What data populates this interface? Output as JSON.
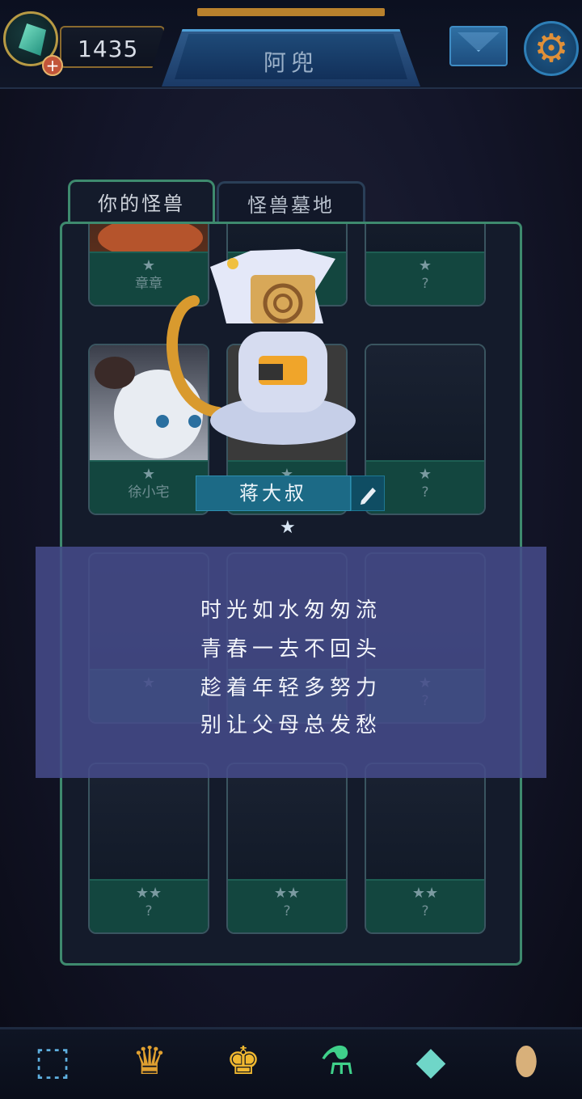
{
  "header": {
    "currency_value": "1435",
    "plus_label": "+",
    "title": "阿兜"
  },
  "tabs": [
    {
      "label": "你的怪兽",
      "active": true
    },
    {
      "label": "怪兽墓地",
      "active": false
    }
  ],
  "cards": [
    {
      "name": "章章",
      "stars": "★"
    },
    {
      "name": "",
      "stars": "★"
    },
    {
      "name": "?",
      "stars": "★"
    },
    {
      "name": "徐小宅",
      "stars": "★"
    },
    {
      "name": "",
      "stars": "★"
    },
    {
      "name": "?",
      "stars": "★"
    },
    {
      "name": "",
      "stars": "★"
    },
    {
      "name": "",
      "stars": ""
    },
    {
      "name": "?",
      "stars": "★"
    },
    {
      "name": "?",
      "stars": "★★"
    },
    {
      "name": "?",
      "stars": "★★"
    },
    {
      "name": "?",
      "stars": "★★"
    }
  ],
  "selected_monster": {
    "name": "蒋大叔",
    "stars": "★"
  },
  "poem": [
    "时光如水匆匆流",
    "青春一去不回头",
    "趁着年轻多努力",
    "别让父母总发愁"
  ],
  "colors": {
    "accent_green": "#3e8a6e",
    "name_plate": "#1c6a86",
    "poem_overlay": "#464c8a",
    "currency_gold": "#b79a44"
  },
  "icons": {
    "mail": "envelope-icon",
    "settings": "gear-icon",
    "edit": "pencil-icon",
    "currency": "gem-icon"
  },
  "bottom_nav": [
    {
      "name": "map"
    },
    {
      "name": "trophy"
    },
    {
      "name": "crown"
    },
    {
      "name": "potion"
    },
    {
      "name": "shop"
    },
    {
      "name": "egg"
    }
  ]
}
